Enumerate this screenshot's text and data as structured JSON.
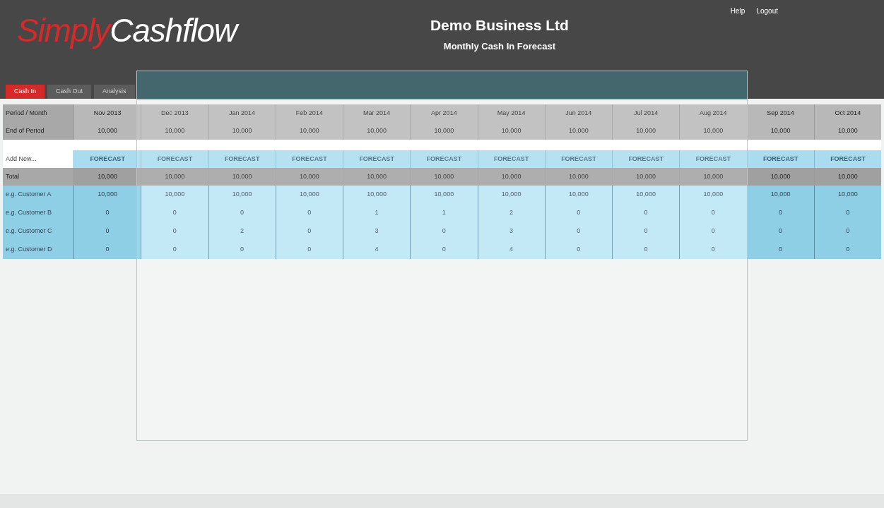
{
  "header": {
    "logo_part_1": "Simply",
    "logo_part_2": "Cashflow",
    "company": "Demo Business Ltd",
    "subtitle": "Monthly Cash In Forecast",
    "links": [
      "Help",
      "Logout"
    ]
  },
  "tabs": [
    {
      "label": "Cash In",
      "selected": true
    },
    {
      "label": "Cash Out",
      "selected": false
    },
    {
      "label": "Analysis",
      "selected": false
    }
  ],
  "table": {
    "period_row": {
      "label": "Period / Month",
      "cells": [
        "Nov 2013",
        "Dec 2013",
        "Jan 2014",
        "Feb 2014",
        "Mar 2014",
        "Apr 2014",
        "May 2014",
        "Jun 2014",
        "Jul 2014",
        "Aug 2014",
        "Sep 2014",
        "Oct 2014"
      ]
    },
    "end_row": {
      "label": "End of Period",
      "cells": [
        "10,000",
        "10,000",
        "10,000",
        "10,000",
        "10,000",
        "10,000",
        "10,000",
        "10,000",
        "10,000",
        "10,000",
        "10,000",
        "10,000"
      ]
    },
    "add_new": "Add New...",
    "type_row": [
      "FORECAST",
      "FORECAST",
      "FORECAST",
      "FORECAST",
      "FORECAST",
      "FORECAST",
      "FORECAST",
      "FORECAST",
      "FORECAST",
      "FORECAST",
      "FORECAST",
      "FORECAST"
    ],
    "total_row": {
      "label": "Total",
      "cells": [
        "10,000",
        "10,000",
        "10,000",
        "10,000",
        "10,000",
        "10,000",
        "10,000",
        "10,000",
        "10,000",
        "10,000",
        "10,000",
        "10,000"
      ]
    },
    "rows": [
      {
        "label": "e.g. Customer A",
        "cells": [
          "10,000",
          "10,000",
          "10,000",
          "10,000",
          "10,000",
          "10,000",
          "10,000",
          "10,000",
          "10,000",
          "10,000",
          "10,000",
          "10,000"
        ]
      },
      {
        "label": "e.g. Customer B",
        "cells": [
          "0",
          "0",
          "0",
          "0",
          "1",
          "1",
          "2",
          "0",
          "0",
          "0",
          "0",
          "0"
        ]
      },
      {
        "label": "e.g. Customer C",
        "cells": [
          "0",
          "0",
          "2",
          "0",
          "3",
          "0",
          "3",
          "0",
          "0",
          "0",
          "0",
          "0"
        ]
      },
      {
        "label": "e.g. Customer D",
        "cells": [
          "0",
          "0",
          "0",
          "0",
          "4",
          "0",
          "4",
          "0",
          "0",
          "0",
          "0",
          "0"
        ]
      }
    ]
  }
}
